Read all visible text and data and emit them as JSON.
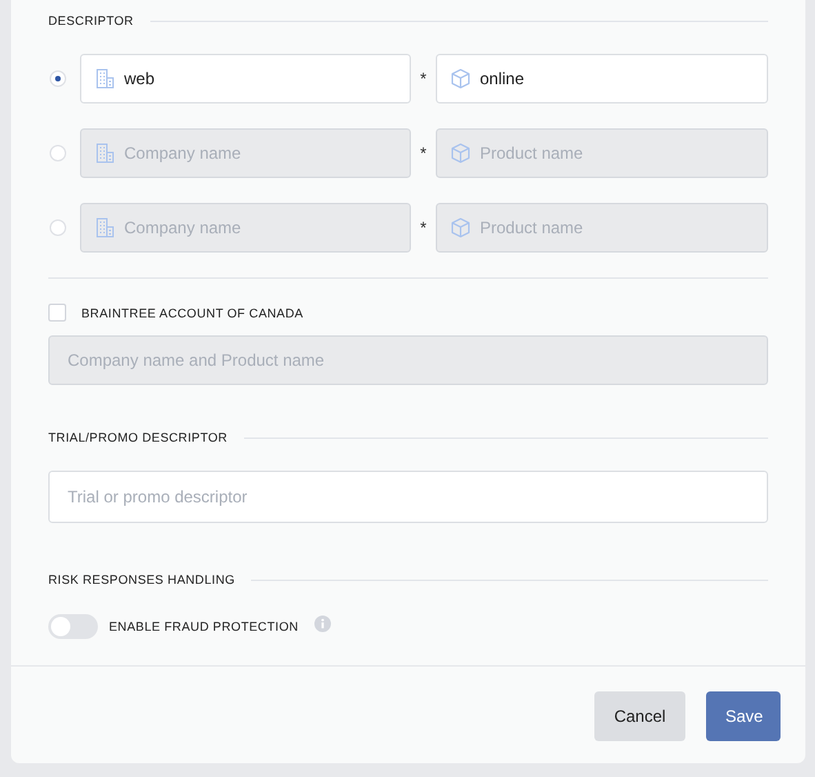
{
  "descriptor": {
    "heading": "DESCRIPTOR",
    "rows": [
      {
        "selected": true,
        "disabled": false,
        "company": {
          "value": "web"
        },
        "separator": "*",
        "product": {
          "value": "online"
        }
      },
      {
        "selected": false,
        "disabled": true,
        "company": {
          "placeholder": "Company name"
        },
        "separator": "*",
        "product": {
          "placeholder": "Product name"
        }
      },
      {
        "selected": false,
        "disabled": true,
        "company": {
          "placeholder": "Company name"
        },
        "separator": "*",
        "product": {
          "placeholder": "Product name"
        }
      }
    ]
  },
  "canada": {
    "label": "BRAINTREE ACCOUNT OF CANADA",
    "checked": false,
    "field": {
      "placeholder": "Company name and Product name",
      "disabled": true
    }
  },
  "trial": {
    "heading": "TRIAL/PROMO DESCRIPTOR",
    "field": {
      "placeholder": "Trial or promo descriptor",
      "disabled": false
    }
  },
  "risk": {
    "heading": "RISK RESPONSES HANDLING",
    "toggle": {
      "label": "ENABLE FRAUD PROTECTION",
      "on": false
    }
  },
  "buttons": [
    {
      "label": "Cancel",
      "kind": "secondary"
    },
    {
      "label": "Save",
      "kind": "primary"
    }
  ]
}
